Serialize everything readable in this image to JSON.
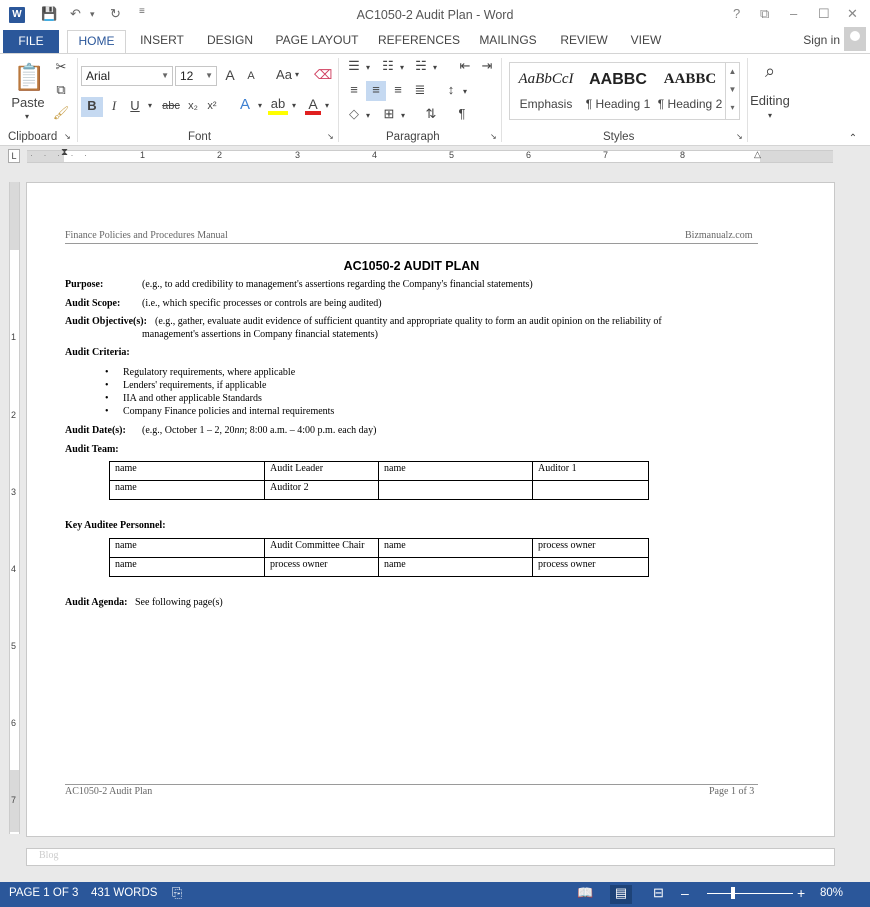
{
  "window": {
    "title": "AC1050-2 Audit Plan - Word",
    "help": "?",
    "minimize": "–",
    "restore": "☐",
    "close": "✕"
  },
  "ribbon_tabs": [
    "FILE",
    "HOME",
    "INSERT",
    "DESIGN",
    "PAGE LAYOUT",
    "REFERENCES",
    "MAILINGS",
    "REVIEW",
    "VIEW"
  ],
  "signin": "Sign in",
  "clipboard": {
    "paste_label": "Paste",
    "group_label": "Clipboard"
  },
  "font": {
    "name": "Arial",
    "size": "12",
    "group_label": "Font",
    "bold": "B",
    "italic": "I",
    "underline": "U",
    "strike": "abc",
    "subscript": "x₂",
    "superscript": "x²",
    "grow": "A",
    "shrink": "A",
    "change_case": "Aa"
  },
  "paragraph": {
    "group_label": "Paragraph"
  },
  "styles": {
    "group_label": "Styles",
    "items": [
      {
        "preview": "AaBbCcI",
        "name": "Emphasis"
      },
      {
        "preview": "AABBC",
        "name": "¶ Heading 1"
      },
      {
        "preview": "AABBC",
        "name": "¶ Heading 2"
      }
    ]
  },
  "editing": {
    "label": "Editing"
  },
  "ruler_numbers": [
    "1",
    "1",
    "2",
    "3",
    "4",
    "5",
    "6",
    "7",
    "8"
  ],
  "vruler_numbers": [
    "1",
    "1",
    "2",
    "3",
    "4",
    "5",
    "6",
    "7"
  ],
  "document": {
    "header_left": "Finance Policies and Procedures Manual",
    "header_right": "Bizmanualz.com",
    "title": "AC1050-2 AUDIT PLAN",
    "purpose_label": "Purpose:",
    "purpose_text": "(e.g., to add credibility to management's assertions regarding the Company's financial statements)",
    "scope_label": "Audit Scope:",
    "scope_text": "(i.e., which specific processes or controls are being audited)",
    "objective_label": "Audit Objective(s):",
    "objective_line1": "(e.g., gather, evaluate audit evidence of sufficient quantity and appropriate quality to form an audit opinion on the reliability of",
    "objective_line2": "management's assertions in Company financial statements)",
    "criteria_label": "Audit Criteria:",
    "criteria_items": [
      "Regulatory requirements, where applicable",
      "Lenders' requirements, if applicable",
      "IIA and other applicable Standards",
      "Company Finance policies and internal requirements"
    ],
    "dates_label": "Audit Date(s):",
    "dates_text_a": "(e.g., October 1 – 2, 20",
    "dates_text_nn": "nn",
    "dates_text_b": "; 8:00 a.m. – 4:00 p.m. each day)",
    "team_label": "Audit Team:",
    "team_rows": [
      [
        "name",
        "Audit Leader",
        "name",
        "Auditor 1"
      ],
      [
        "name",
        "Auditor 2",
        "",
        ""
      ]
    ],
    "personnel_label": "Key Auditee Personnel:",
    "personnel_rows": [
      [
        "name",
        "Audit Committee Chair",
        "name",
        "process owner"
      ],
      [
        "name",
        "process owner",
        "name",
        "process owner"
      ]
    ],
    "agenda_label": "Audit Agenda:",
    "agenda_text": "See following page(s)",
    "footer_left": "AC1050-2 Audit Plan",
    "footer_right": "Page 1 of 3",
    "next_page_text": "Blog"
  },
  "status": {
    "page": "PAGE 1 OF 3",
    "words": "431 WORDS",
    "zoom": "80%",
    "zoom_out": "–",
    "zoom_in": "+"
  }
}
